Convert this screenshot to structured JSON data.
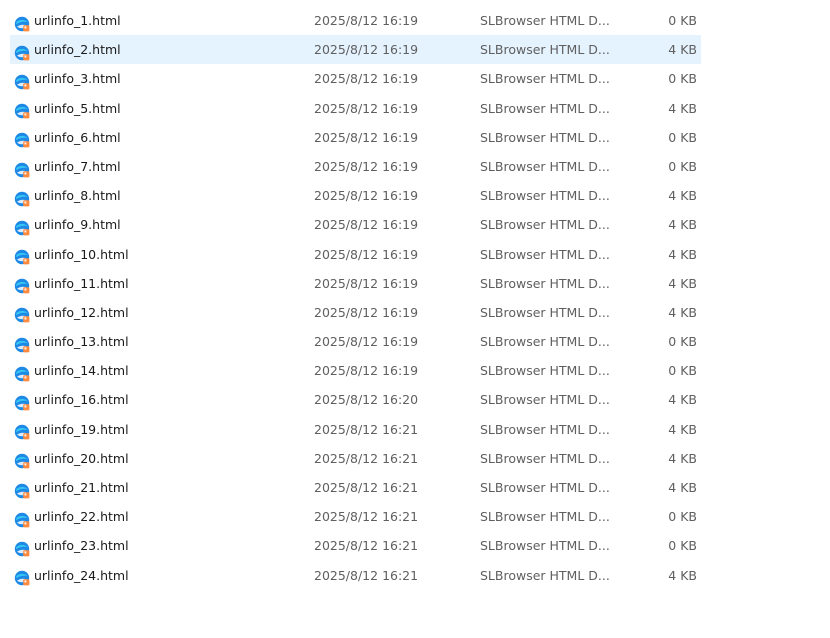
{
  "icon": "slbrowser-html-file-icon",
  "colors": {
    "selected_row": "#e5f3ff",
    "icon_blue": "#1e88e5",
    "icon_cyan": "#36c6f4",
    "icon_orange": "#ff8a3d"
  },
  "files": [
    {
      "name": "urlinfo_1.html",
      "date": "2025/8/12 16:19",
      "type": "SLBrowser HTML D...",
      "size": "0 KB",
      "selected": false
    },
    {
      "name": "urlinfo_2.html",
      "date": "2025/8/12 16:19",
      "type": "SLBrowser HTML D...",
      "size": "4 KB",
      "selected": true
    },
    {
      "name": "urlinfo_3.html",
      "date": "2025/8/12 16:19",
      "type": "SLBrowser HTML D...",
      "size": "0 KB",
      "selected": false
    },
    {
      "name": "urlinfo_5.html",
      "date": "2025/8/12 16:19",
      "type": "SLBrowser HTML D...",
      "size": "4 KB",
      "selected": false
    },
    {
      "name": "urlinfo_6.html",
      "date": "2025/8/12 16:19",
      "type": "SLBrowser HTML D...",
      "size": "0 KB",
      "selected": false
    },
    {
      "name": "urlinfo_7.html",
      "date": "2025/8/12 16:19",
      "type": "SLBrowser HTML D...",
      "size": "0 KB",
      "selected": false
    },
    {
      "name": "urlinfo_8.html",
      "date": "2025/8/12 16:19",
      "type": "SLBrowser HTML D...",
      "size": "4 KB",
      "selected": false
    },
    {
      "name": "urlinfo_9.html",
      "date": "2025/8/12 16:19",
      "type": "SLBrowser HTML D...",
      "size": "4 KB",
      "selected": false
    },
    {
      "name": "urlinfo_10.html",
      "date": "2025/8/12 16:19",
      "type": "SLBrowser HTML D...",
      "size": "4 KB",
      "selected": false
    },
    {
      "name": "urlinfo_11.html",
      "date": "2025/8/12 16:19",
      "type": "SLBrowser HTML D...",
      "size": "4 KB",
      "selected": false
    },
    {
      "name": "urlinfo_12.html",
      "date": "2025/8/12 16:19",
      "type": "SLBrowser HTML D...",
      "size": "4 KB",
      "selected": false
    },
    {
      "name": "urlinfo_13.html",
      "date": "2025/8/12 16:19",
      "type": "SLBrowser HTML D...",
      "size": "0 KB",
      "selected": false
    },
    {
      "name": "urlinfo_14.html",
      "date": "2025/8/12 16:19",
      "type": "SLBrowser HTML D...",
      "size": "0 KB",
      "selected": false
    },
    {
      "name": "urlinfo_16.html",
      "date": "2025/8/12 16:20",
      "type": "SLBrowser HTML D...",
      "size": "4 KB",
      "selected": false
    },
    {
      "name": "urlinfo_19.html",
      "date": "2025/8/12 16:21",
      "type": "SLBrowser HTML D...",
      "size": "4 KB",
      "selected": false
    },
    {
      "name": "urlinfo_20.html",
      "date": "2025/8/12 16:21",
      "type": "SLBrowser HTML D...",
      "size": "4 KB",
      "selected": false
    },
    {
      "name": "urlinfo_21.html",
      "date": "2025/8/12 16:21",
      "type": "SLBrowser HTML D...",
      "size": "4 KB",
      "selected": false
    },
    {
      "name": "urlinfo_22.html",
      "date": "2025/8/12 16:21",
      "type": "SLBrowser HTML D...",
      "size": "0 KB",
      "selected": false
    },
    {
      "name": "urlinfo_23.html",
      "date": "2025/8/12 16:21",
      "type": "SLBrowser HTML D...",
      "size": "0 KB",
      "selected": false
    },
    {
      "name": "urlinfo_24.html",
      "date": "2025/8/12 16:21",
      "type": "SLBrowser HTML D...",
      "size": "4 KB",
      "selected": false
    }
  ]
}
